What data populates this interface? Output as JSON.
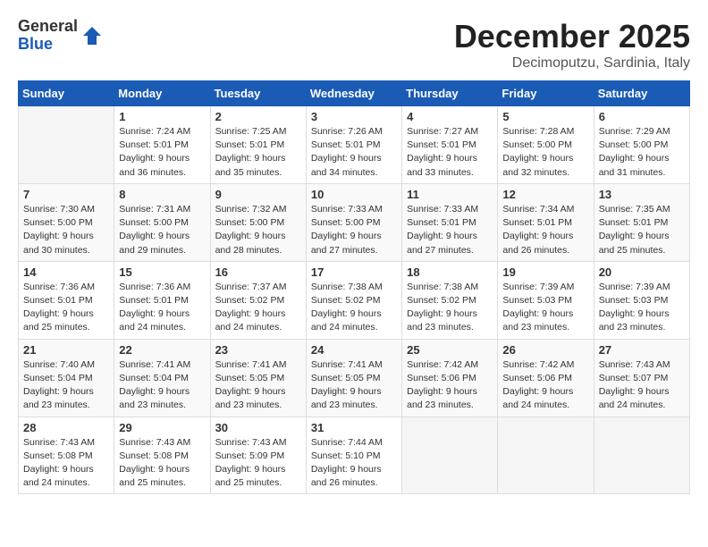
{
  "logo": {
    "general": "General",
    "blue": "Blue"
  },
  "header": {
    "month": "December 2025",
    "location": "Decimoputzu, Sardinia, Italy"
  },
  "weekdays": [
    "Sunday",
    "Monday",
    "Tuesday",
    "Wednesday",
    "Thursday",
    "Friday",
    "Saturday"
  ],
  "weeks": [
    [
      {
        "day": "",
        "info": ""
      },
      {
        "day": "1",
        "info": "Sunrise: 7:24 AM\nSunset: 5:01 PM\nDaylight: 9 hours\nand 36 minutes."
      },
      {
        "day": "2",
        "info": "Sunrise: 7:25 AM\nSunset: 5:01 PM\nDaylight: 9 hours\nand 35 minutes."
      },
      {
        "day": "3",
        "info": "Sunrise: 7:26 AM\nSunset: 5:01 PM\nDaylight: 9 hours\nand 34 minutes."
      },
      {
        "day": "4",
        "info": "Sunrise: 7:27 AM\nSunset: 5:01 PM\nDaylight: 9 hours\nand 33 minutes."
      },
      {
        "day": "5",
        "info": "Sunrise: 7:28 AM\nSunset: 5:00 PM\nDaylight: 9 hours\nand 32 minutes."
      },
      {
        "day": "6",
        "info": "Sunrise: 7:29 AM\nSunset: 5:00 PM\nDaylight: 9 hours\nand 31 minutes."
      }
    ],
    [
      {
        "day": "7",
        "info": "Sunrise: 7:30 AM\nSunset: 5:00 PM\nDaylight: 9 hours\nand 30 minutes."
      },
      {
        "day": "8",
        "info": "Sunrise: 7:31 AM\nSunset: 5:00 PM\nDaylight: 9 hours\nand 29 minutes."
      },
      {
        "day": "9",
        "info": "Sunrise: 7:32 AM\nSunset: 5:00 PM\nDaylight: 9 hours\nand 28 minutes."
      },
      {
        "day": "10",
        "info": "Sunrise: 7:33 AM\nSunset: 5:00 PM\nDaylight: 9 hours\nand 27 minutes."
      },
      {
        "day": "11",
        "info": "Sunrise: 7:33 AM\nSunset: 5:01 PM\nDaylight: 9 hours\nand 27 minutes."
      },
      {
        "day": "12",
        "info": "Sunrise: 7:34 AM\nSunset: 5:01 PM\nDaylight: 9 hours\nand 26 minutes."
      },
      {
        "day": "13",
        "info": "Sunrise: 7:35 AM\nSunset: 5:01 PM\nDaylight: 9 hours\nand 25 minutes."
      }
    ],
    [
      {
        "day": "14",
        "info": "Sunrise: 7:36 AM\nSunset: 5:01 PM\nDaylight: 9 hours\nand 25 minutes."
      },
      {
        "day": "15",
        "info": "Sunrise: 7:36 AM\nSunset: 5:01 PM\nDaylight: 9 hours\nand 24 minutes."
      },
      {
        "day": "16",
        "info": "Sunrise: 7:37 AM\nSunset: 5:02 PM\nDaylight: 9 hours\nand 24 minutes."
      },
      {
        "day": "17",
        "info": "Sunrise: 7:38 AM\nSunset: 5:02 PM\nDaylight: 9 hours\nand 24 minutes."
      },
      {
        "day": "18",
        "info": "Sunrise: 7:38 AM\nSunset: 5:02 PM\nDaylight: 9 hours\nand 23 minutes."
      },
      {
        "day": "19",
        "info": "Sunrise: 7:39 AM\nSunset: 5:03 PM\nDaylight: 9 hours\nand 23 minutes."
      },
      {
        "day": "20",
        "info": "Sunrise: 7:39 AM\nSunset: 5:03 PM\nDaylight: 9 hours\nand 23 minutes."
      }
    ],
    [
      {
        "day": "21",
        "info": "Sunrise: 7:40 AM\nSunset: 5:04 PM\nDaylight: 9 hours\nand 23 minutes."
      },
      {
        "day": "22",
        "info": "Sunrise: 7:41 AM\nSunset: 5:04 PM\nDaylight: 9 hours\nand 23 minutes."
      },
      {
        "day": "23",
        "info": "Sunrise: 7:41 AM\nSunset: 5:05 PM\nDaylight: 9 hours\nand 23 minutes."
      },
      {
        "day": "24",
        "info": "Sunrise: 7:41 AM\nSunset: 5:05 PM\nDaylight: 9 hours\nand 23 minutes."
      },
      {
        "day": "25",
        "info": "Sunrise: 7:42 AM\nSunset: 5:06 PM\nDaylight: 9 hours\nand 23 minutes."
      },
      {
        "day": "26",
        "info": "Sunrise: 7:42 AM\nSunset: 5:06 PM\nDaylight: 9 hours\nand 24 minutes."
      },
      {
        "day": "27",
        "info": "Sunrise: 7:43 AM\nSunset: 5:07 PM\nDaylight: 9 hours\nand 24 minutes."
      }
    ],
    [
      {
        "day": "28",
        "info": "Sunrise: 7:43 AM\nSunset: 5:08 PM\nDaylight: 9 hours\nand 24 minutes."
      },
      {
        "day": "29",
        "info": "Sunrise: 7:43 AM\nSunset: 5:08 PM\nDaylight: 9 hours\nand 25 minutes."
      },
      {
        "day": "30",
        "info": "Sunrise: 7:43 AM\nSunset: 5:09 PM\nDaylight: 9 hours\nand 25 minutes."
      },
      {
        "day": "31",
        "info": "Sunrise: 7:44 AM\nSunset: 5:10 PM\nDaylight: 9 hours\nand 26 minutes."
      },
      {
        "day": "",
        "info": ""
      },
      {
        "day": "",
        "info": ""
      },
      {
        "day": "",
        "info": ""
      }
    ]
  ]
}
